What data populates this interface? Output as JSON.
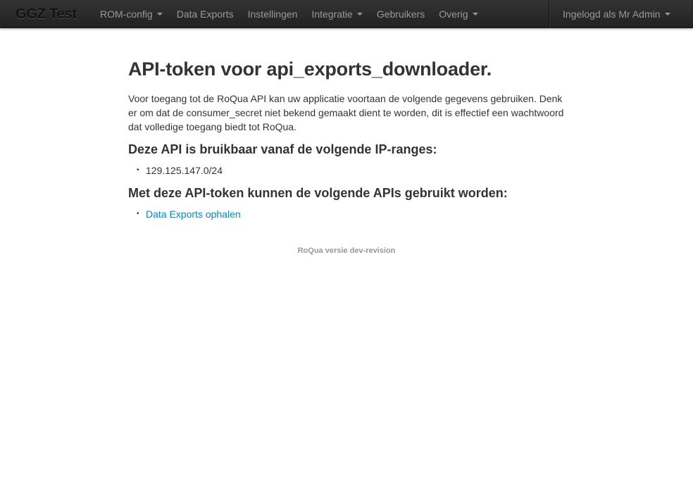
{
  "navbar": {
    "brand": "GGZ Test",
    "items": [
      {
        "label": "ROM-config",
        "dropdown": true
      },
      {
        "label": "Data Exports",
        "dropdown": false
      },
      {
        "label": "Instellingen",
        "dropdown": false
      },
      {
        "label": "Integratie",
        "dropdown": true
      },
      {
        "label": "Gebruikers",
        "dropdown": false
      },
      {
        "label": "Overig",
        "dropdown": true
      }
    ],
    "user_menu": "Ingelogd als Mr Admin"
  },
  "main": {
    "title": "API-token voor api_exports_downloader.",
    "intro": "Voor toegang tot de RoQua API kan uw applicatie voortaan de volgende gegevens gebruiken. Denk er om dat de consumer_secret niet bekend gemaakt dient te worden, dit is effectief een wachtwoord dat volledige toegang biedt tot RoQua.",
    "ip_heading": "Deze API is bruikbaar vanaf de volgende IP-ranges:",
    "ip_ranges": [
      "129.125.147.0/24"
    ],
    "apis_heading": "Met deze API-token kunnen de volgende APIs gebruikt worden:",
    "apis": [
      "Data Exports ophalen"
    ]
  },
  "footer": {
    "version": "RoQua versie dev-revision"
  },
  "colors": {
    "navbar_bg": "#222222",
    "nav_text": "#999999",
    "link": "#0088cc",
    "text": "#333333"
  }
}
